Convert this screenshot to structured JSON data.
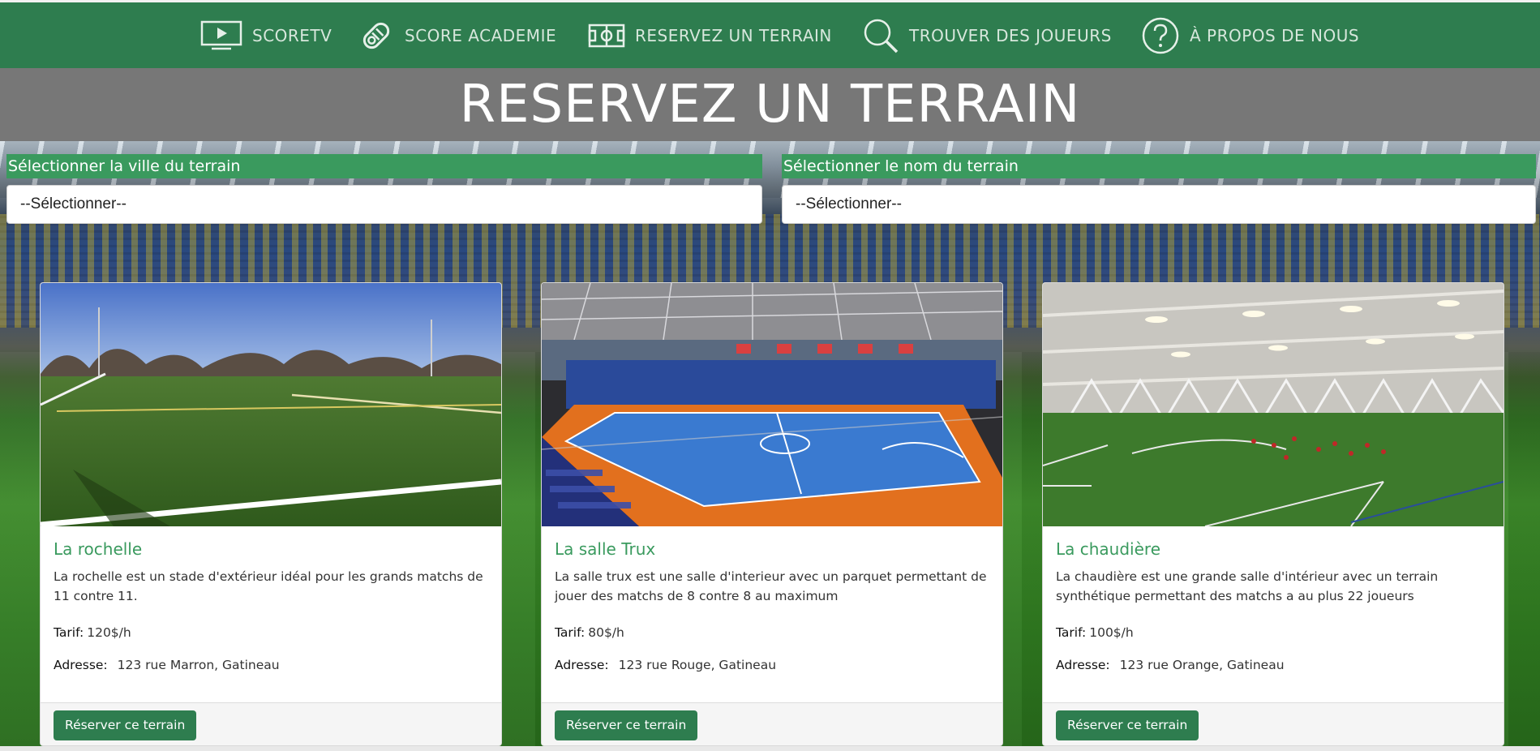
{
  "nav": {
    "items": [
      {
        "label": "SCORETV",
        "icon": "play-icon"
      },
      {
        "label": "SCORE ACADEMIE",
        "icon": "diploma-icon"
      },
      {
        "label": "RESERVEZ UN TERRAIN",
        "icon": "field-icon"
      },
      {
        "label": "TROUVER DES JOUEURS",
        "icon": "search-icon"
      },
      {
        "label": "À PROPOS DE NOUS",
        "icon": "question-icon"
      }
    ]
  },
  "page": {
    "title": "RESERVEZ UN TERRAIN"
  },
  "filters": {
    "city": {
      "label": "Sélectionner la ville du terrain",
      "selected": "--Sélectionner--"
    },
    "name": {
      "label": "Sélectionner le nom du terrain",
      "selected": "--Sélectionner--"
    }
  },
  "fields": [
    {
      "name": "La rochelle",
      "description": "La rochelle est un stade d'extérieur idéal pour les grands matchs de 11 contre 11.",
      "tarif_label": "Tarif:",
      "tarif": "120$/h",
      "adresse_label": "Adresse:",
      "adresse": "123 rue Marron, Gatineau",
      "button": "Réserver ce terrain"
    },
    {
      "name": "La salle Trux",
      "description": "La salle trux est une salle d'interieur avec un parquet permettant de jouer des matchs de 8 contre 8 au maximum",
      "tarif_label": "Tarif:",
      "tarif": "80$/h",
      "adresse_label": "Adresse:",
      "adresse": "123 rue Rouge, Gatineau",
      "button": "Réserver ce terrain"
    },
    {
      "name": "La chaudière",
      "description": "La chaudière est une grande salle d'intérieur avec un terrain synthétique permettant des matchs a au plus 22 joueurs",
      "tarif_label": "Tarif:",
      "tarif": "100$/h",
      "adresse_label": "Adresse:",
      "adresse": "123 rue Orange, Gatineau",
      "button": "Réserver ce terrain"
    }
  ],
  "colors": {
    "nav_bg": "#2e7d4f",
    "accent": "#3a9a5e",
    "banner_bg": "#777777",
    "button_bg": "#2e7d4f"
  }
}
